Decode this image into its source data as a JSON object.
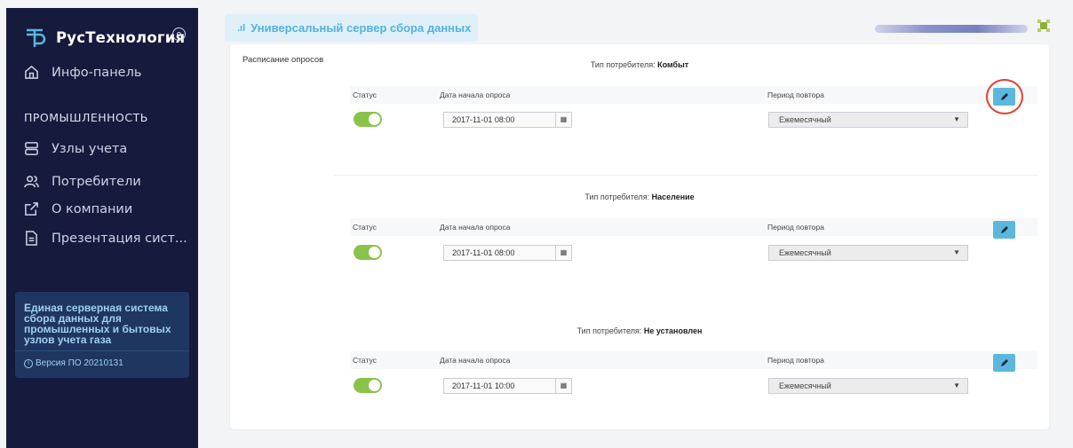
{
  "sidebar": {
    "brand": "РусТехнология",
    "nav": [
      {
        "label": "Инфо-панель",
        "icon": "home-icon"
      },
      {
        "label": "Узлы учета",
        "icon": "server-icon"
      },
      {
        "label": "Потребители",
        "icon": "users-icon"
      },
      {
        "label": "О компании",
        "icon": "external-link-icon"
      },
      {
        "label": "Презентация сист...",
        "icon": "document-icon"
      }
    ],
    "section_title": "ПРОМЫШЛЕННОСТЬ",
    "info_text": "Единая серверная система сбора данных для промышленных и бытовых узлов учета газа",
    "version": "Версия ПО 20210131"
  },
  "topbar": {
    "title": "Универсальный сервер сбора данных"
  },
  "card": {
    "label": "Расписание опросов",
    "type_prefix": "Тип потребителя:",
    "col_status": "Статус",
    "col_date": "Дата начала опроса",
    "col_period": "Период повтора",
    "blocks": [
      {
        "type": "Комбыт",
        "status": true,
        "date": "2017-11-01 08:00",
        "period": "Ежемесячный"
      },
      {
        "type": "Население",
        "status": true,
        "date": "2017-11-01 08:00",
        "period": "Ежемесячный"
      },
      {
        "type": "Не установлен",
        "status": true,
        "date": "2017-11-01 10:00",
        "period": "Ежемесячный"
      }
    ]
  },
  "colors": {
    "sidebar_bg": "#161a3d",
    "accent": "#5bb8dc",
    "toggle_on": "#8bc34a",
    "highlight": "#e2402e"
  }
}
